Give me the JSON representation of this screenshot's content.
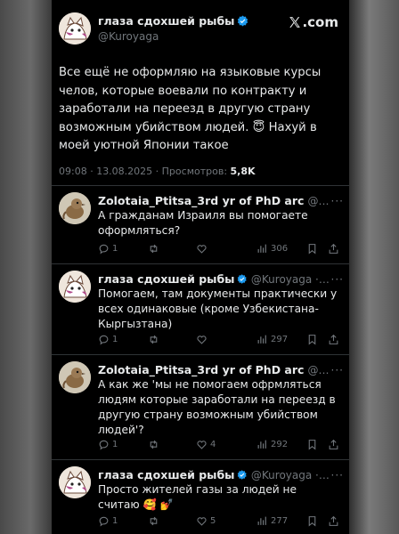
{
  "brand": {
    "site": ".com"
  },
  "post": {
    "author_name": "глаза сдохшей рыбы",
    "author_handle": "@Kuroyaga",
    "text": "Все ещё не оформляю на языковые курсы челов, которые воевали по контракту и заработали на переезд в другую страну возможным убийством людей. 😇 Нахуй в моей уютной Японии такое",
    "time": "09:08 · 13.08.2025 · Просмотров: ",
    "views": "5,8K"
  },
  "replies": [
    {
      "author_name": "Zolotaia_Ptitsa_3rd yr of PhD arc",
      "author_handle": "@sel... · 5 ч.",
      "text": "А гражданам Израиля вы помогаете оформляться?",
      "reply_count": "1",
      "repost_count": "",
      "like_count": "",
      "view_count": "306"
    },
    {
      "author_name": "глаза сдохшей рыбы",
      "author_handle": "@Kuroyaga · 5 ч.",
      "text": "Помогаем, там документы практически у всех одинаковые (кроме Узбекистана-Кыргызтана)",
      "reply_count": "1",
      "repost_count": "",
      "like_count": "",
      "view_count": "297"
    },
    {
      "author_name": "Zolotaia_Ptitsa_3rd yr of PhD arc",
      "author_handle": "@sel... · 5 ч.",
      "text": "А как же 'мы не помогаем офрмляться людям которые заработали на переезд в другую страну возможным убийством людей'?",
      "reply_count": "1",
      "repost_count": "",
      "like_count": "4",
      "view_count": "292"
    },
    {
      "author_name": "глаза сдохшей рыбы",
      "author_handle": "@Kuroyaga · 5 ч.",
      "text": "Просто жителей газы за людей не считаю 🥰 💅",
      "reply_count": "1",
      "repost_count": "",
      "like_count": "5",
      "view_count": "277"
    }
  ],
  "colors": {
    "verified": "#1d9bf0",
    "muted": "#71767b",
    "text": "#e7e9ea"
  }
}
